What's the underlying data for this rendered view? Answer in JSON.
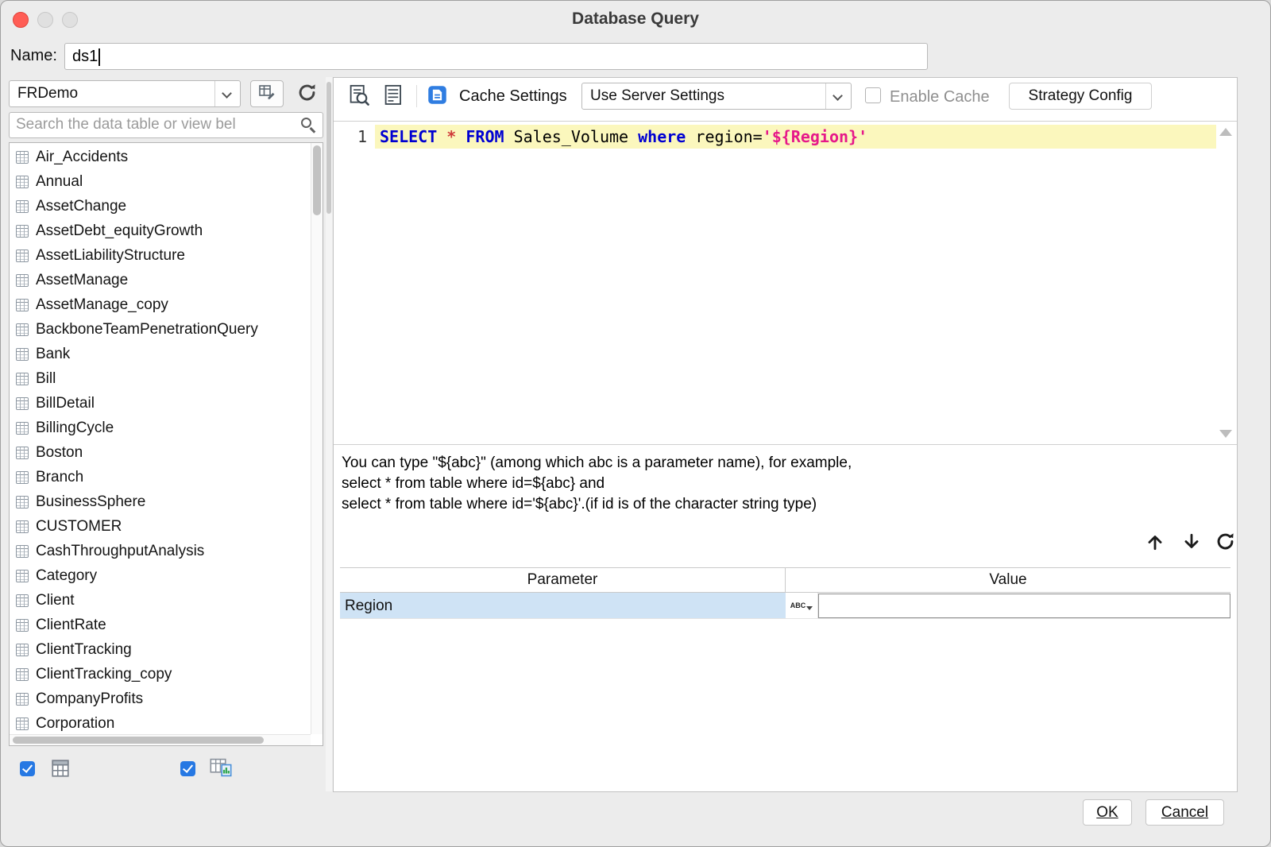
{
  "window": {
    "title": "Database Query"
  },
  "name_row": {
    "label": "Name:",
    "value": "ds1"
  },
  "left_panel": {
    "connection_value": "FRDemo",
    "search_placeholder": "Search the data table or view bel",
    "tables": [
      "Air_Accidents",
      "Annual",
      "AssetChange",
      "AssetDebt_equityGrowth",
      "AssetLiabilityStructure",
      "AssetManage",
      "AssetManage_copy",
      "BackboneTeamPenetrationQuery",
      "Bank",
      "Bill",
      "BillDetail",
      "BillingCycle",
      "Boston",
      "Branch",
      "BusinessSphere",
      "CUSTOMER",
      "CashThroughputAnalysis",
      "Category",
      "Client",
      "ClientRate",
      "ClientTracking",
      "ClientTracking_copy",
      "CompanyProfits",
      "Corporation"
    ]
  },
  "toolbar": {
    "cache_settings_label": "Cache Settings",
    "cache_mode_value": "Use Server Settings",
    "enable_cache_label": "Enable Cache",
    "strategy_config_label": "Strategy Config"
  },
  "editor": {
    "line_number": "1",
    "tokens": [
      {
        "text": "SELECT",
        "type": "keyword"
      },
      {
        "text": " ",
        "type": "plain"
      },
      {
        "text": "*",
        "type": "operator"
      },
      {
        "text": " ",
        "type": "plain"
      },
      {
        "text": "FROM",
        "type": "keyword"
      },
      {
        "text": " Sales_Volume ",
        "type": "plain"
      },
      {
        "text": "where",
        "type": "keyword"
      },
      {
        "text": " region=",
        "type": "plain"
      },
      {
        "text": "'${Region}'",
        "type": "string"
      }
    ]
  },
  "help": {
    "line1": "You can type \"${abc}\" (among which abc is a parameter name), for example,",
    "line2": "select * from table where id=${abc} and",
    "line3": "select * from table where id='${abc}'.(if id is of the character string type)"
  },
  "param_table": {
    "headers": {
      "parameter": "Parameter",
      "value": "Value"
    },
    "rows": [
      {
        "name": "Region",
        "type_label": "ABC",
        "value": ""
      }
    ]
  },
  "footer": {
    "ok_label": "OK",
    "cancel_label": "Cancel"
  },
  "colors": {
    "accent_blue": "#2678e3",
    "sql_keyword": "#0000d2",
    "sql_operator": "#cf3a3a",
    "sql_string": "#e6198a",
    "line_highlight": "#fbf7bd",
    "selected_row": "#cfe3f5"
  }
}
